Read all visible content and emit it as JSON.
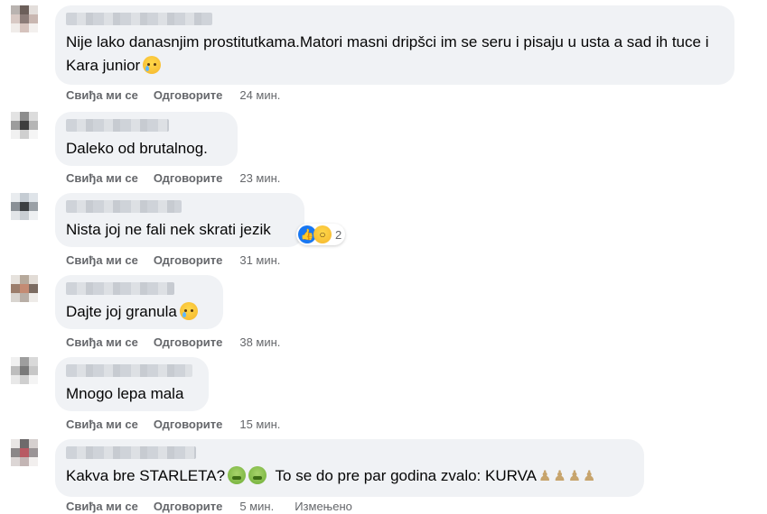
{
  "labels": {
    "like": "Свиђа ми се",
    "reply": "Одговорите",
    "edited": "Измењено"
  },
  "comments": [
    {
      "text": "Nije lako danasnjim prostitutkama.Matori masni dripšci im se seru i pisaju u usta a sad ih tuce i Kara junior",
      "time": "24 мин."
    },
    {
      "text": "Daleko od brutalnog.",
      "time": "23 мин."
    },
    {
      "text": "Nista joj ne fali nek skrati jezik",
      "time": "31 мин.",
      "reaction_count": "2"
    },
    {
      "text": "Dajte joj granula",
      "time": "38 мин."
    },
    {
      "text": "Mnogo lepa mala",
      "time": "15 мин."
    },
    {
      "text": "Kakva bre STARLETA?",
      "text2": "To se do pre par godina zvalo: KURVA",
      "time": "5 мин."
    }
  ]
}
